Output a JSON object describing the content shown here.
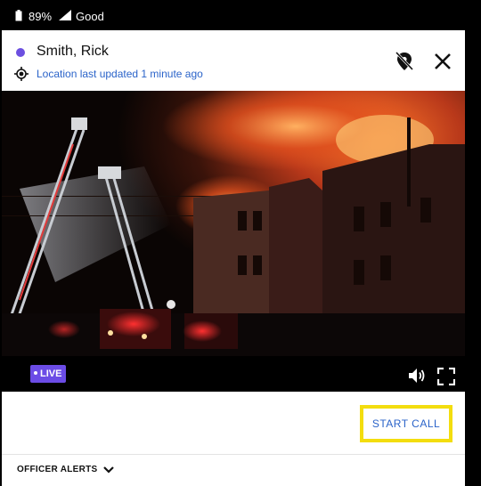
{
  "status_bar": {
    "battery": "89%",
    "signal": "Good"
  },
  "header": {
    "officer_name": "Smith, Rick",
    "location_status": "Location last updated 1 minute ago",
    "status_dot_color": "#6c4fe0"
  },
  "video": {
    "live_label": "LIVE",
    "live_color": "#6b4ce6"
  },
  "actions": {
    "start_call_label": "START CALL",
    "highlight_color": "#f3dd0e"
  },
  "alerts": {
    "label": "OFFICER ALERTS"
  },
  "icons": [
    "battery-icon",
    "signal-icon",
    "gps-icon",
    "location-pin-off-icon",
    "close-icon",
    "volume-icon",
    "fullscreen-icon",
    "chevron-down-icon"
  ]
}
